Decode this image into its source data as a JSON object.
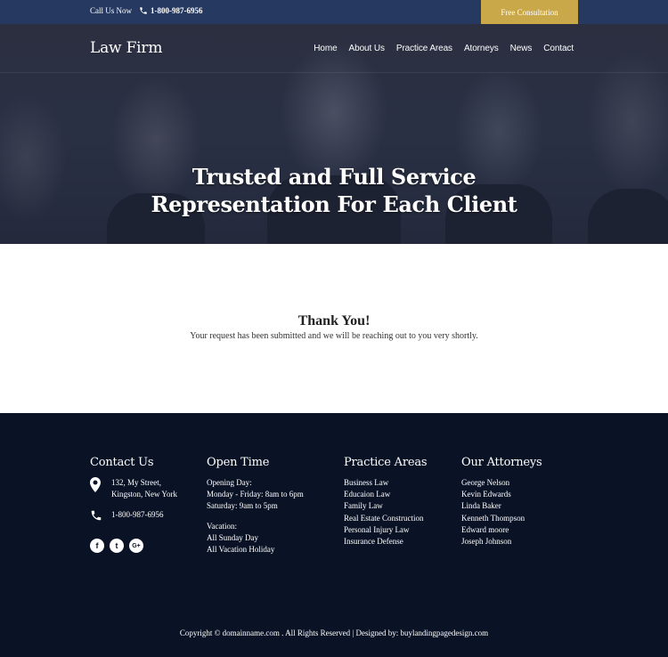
{
  "topbar": {
    "call_label": "Call Us Now",
    "phone": "1-800-987-6956",
    "cta_label": "Free Consultation",
    "colors": {
      "bar": "#263961",
      "cta": "#c9a84a"
    }
  },
  "header": {
    "logo": "Law Firm",
    "nav": [
      "Home",
      "About Us",
      "Practice Areas",
      "Atorneys",
      "News",
      "Contact"
    ]
  },
  "hero": {
    "title_line1": "Trusted and Full Service",
    "title_line2": "Representation For Each Client"
  },
  "thanks": {
    "title": "Thank You!",
    "message": "Your request has been submitted and we will be reaching out to you very shortly."
  },
  "footer": {
    "contact": {
      "title": "Contact Us",
      "address_line1": "132, My Street,",
      "address_line2": "Kingston, New York",
      "phone": "1-800-987-6956",
      "social": [
        {
          "icon": "facebook-icon",
          "glyph": "f"
        },
        {
          "icon": "twitter-icon",
          "glyph": "t"
        },
        {
          "icon": "google-plus-icon",
          "glyph": "G+"
        }
      ]
    },
    "open_time": {
      "title": "Open Time",
      "lines": [
        "Opening Day:",
        "Monday - Friday: 8am to 6pm",
        "Saturday: 9am to 5pm"
      ],
      "vacation": [
        "Vacation:",
        "All Sunday Day",
        "All Vacation Holiday"
      ]
    },
    "practice_areas": {
      "title": "Practice Areas",
      "items": [
        "Business Law",
        "Educaion Law",
        "Family Law",
        "Real Estate Construction",
        "Personal Injury Law",
        "Insurance Defense"
      ]
    },
    "attorneys": {
      "title": "Our Attorneys",
      "items": [
        "George Nelson",
        "Kevin Edwards",
        "Linda Baker",
        "Kenneth Thompson",
        "Edward moore",
        "Joseph Johnson"
      ]
    },
    "copyright": "Copyright © domainname.com . All Rights Reserved | Designed by: buylandingpagedesign.com",
    "colors": {
      "background": "#0a1326"
    }
  }
}
